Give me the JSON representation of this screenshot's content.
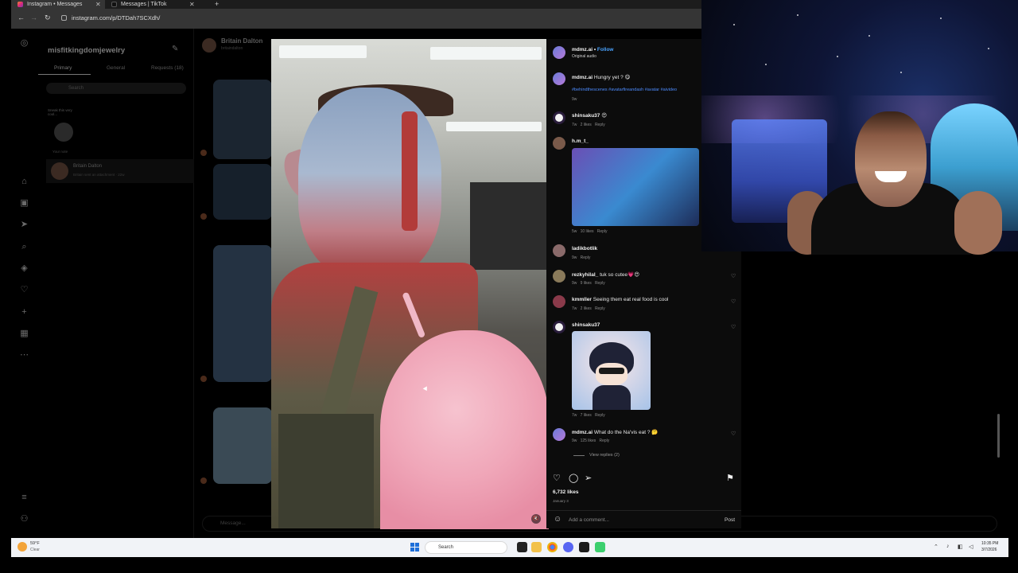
{
  "browser": {
    "tabs": [
      {
        "title": "Instagram • Messages",
        "active": true
      },
      {
        "title": "Messages | TikTok",
        "active": false
      }
    ],
    "url": "instagram.com/p/DTDah7SCXdh/",
    "new_tab_symbol": "+"
  },
  "inbox": {
    "username": "misfitkingdomjewelry",
    "tabs": [
      "Primary",
      "General",
      "Requests (18)"
    ],
    "search_placeholder": "Search",
    "note_text": "Sneak this very cool...",
    "your_note_label": "Your note",
    "conversation": {
      "name": "Britain Dalton",
      "preview": "Britain sent an attachment · 22w"
    }
  },
  "chat": {
    "name": "Britain Dalton",
    "handle": "britaindalton",
    "input_placeholder": "Message..."
  },
  "post": {
    "author": "mdmz.ai",
    "follow_label": "Follow",
    "audio": "Original audio",
    "caption_user": "mdmz.ai",
    "caption_text": "Hungry yet ? 😋",
    "hashtags": "#behindthescenes #avatarfireandash #avatar #aivideo",
    "caption_age": "9w",
    "comments": [
      {
        "user": "shinsaku37",
        "text": "😍",
        "age": "7w",
        "likes": "2 likes",
        "reply": "Reply"
      },
      {
        "user": "h.m_t_",
        "text": "",
        "age": "5w",
        "likes": "10 likes",
        "reply": "Reply"
      },
      {
        "user": "ladikbotlik",
        "text": "",
        "age": "9w",
        "likes": "",
        "reply": "Reply"
      },
      {
        "user": "rezkyhilal_",
        "text": "tuk so cutee💗😍",
        "age": "9w",
        "likes": "9 likes",
        "reply": "Reply"
      },
      {
        "user": "kmmller",
        "text": "Seeing them eat real food is cool",
        "age": "7w",
        "likes": "2 likes",
        "reply": "Reply"
      },
      {
        "user": "shinsaku37",
        "text": "",
        "age": "7w",
        "likes": "7 likes",
        "reply": "Reply"
      },
      {
        "user": "mdmz.ai",
        "text": "What do the Na'vis eat ? 🤔",
        "age": "9w",
        "likes": "125 likes",
        "reply": "Reply"
      }
    ],
    "view_replies": "View replies (2)",
    "likes_total": "6,732 likes",
    "date": "January 3",
    "comment_placeholder": "Add a comment...",
    "post_button": "Post"
  },
  "taskbar": {
    "weather_temp": "59°F",
    "weather_cond": "Clear",
    "search_label": "Search",
    "time": "10:35 PM",
    "date": "3/7/2026"
  },
  "colors": {
    "link_blue": "#4aa3ff",
    "hashtag_blue": "#4d8cff",
    "panel_bg": "#0c0c0c",
    "candy_pink": "#f0a7b9"
  },
  "icons": [
    "instagram-icon",
    "home-icon",
    "reels-icon",
    "messages-icon",
    "search-icon",
    "explore-icon",
    "heart-icon",
    "create-icon",
    "dashboard-icon",
    "threads-icon",
    "menu-icon",
    "edit-icon",
    "like-icon",
    "comment-icon",
    "share-icon",
    "bookmark-icon",
    "emoji-icon",
    "mute-icon"
  ]
}
